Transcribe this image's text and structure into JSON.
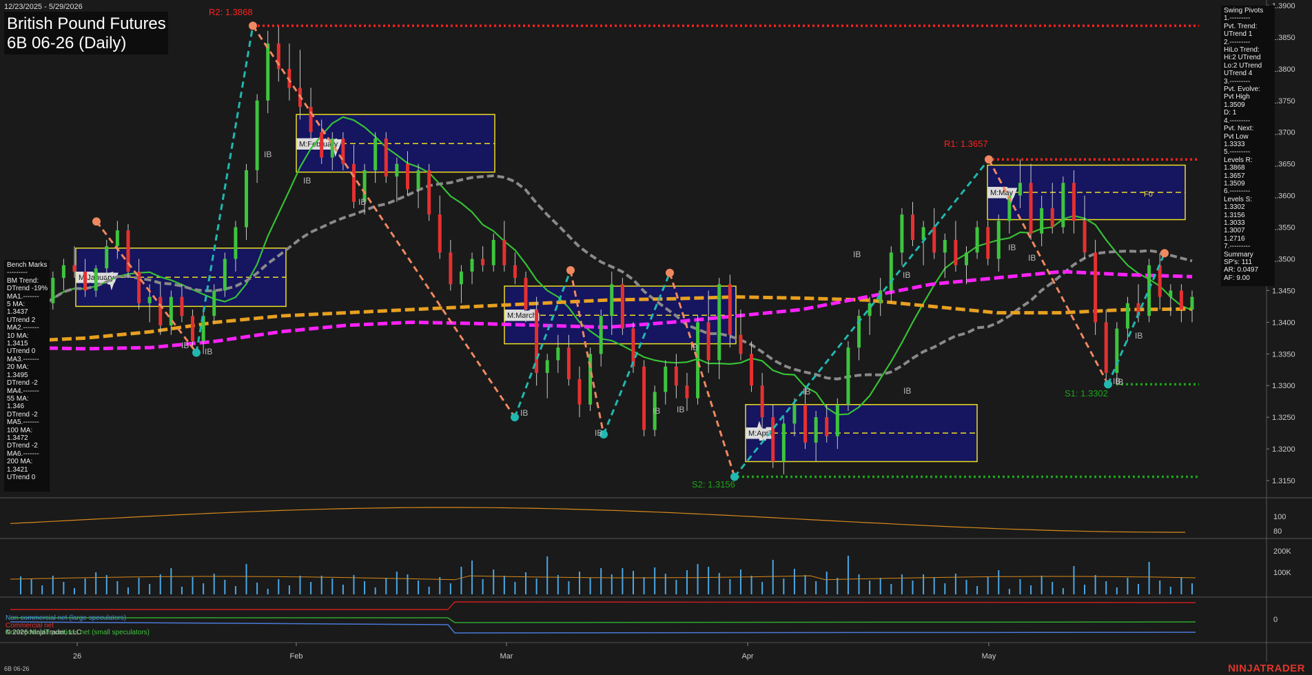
{
  "header": {
    "date_range": "12/23/2025 - 5/29/2026",
    "title_line1": "British Pound Futures",
    "title_line2": "6B 06-26 (Daily)"
  },
  "bench_marks": {
    "lines": [
      "Bench Marks",
      "---------",
      "BM Trend:",
      "DTrend -19%",
      "MA1.-------",
      "5 MA:",
      "1.3437",
      "UTrend 2",
      "MA2.-------",
      "10 MA:",
      "1.3415",
      "UTrend 0",
      "MA3.-------",
      "20 MA:",
      "1.3495",
      "DTrend -2",
      "MA4.-------",
      "55 MA:",
      "1.346",
      "DTrend -2",
      "MA5.-------",
      "100 MA:",
      "1.3472",
      "DTrend -2",
      "MA6.-------",
      "200 MA:",
      "1.3421",
      "UTrend 0"
    ]
  },
  "swing_pivots": {
    "lines": [
      "Swing Pivots",
      "1.---------",
      "Pvt. Trend:",
      "UTrend 1",
      "2.---------",
      "HiLo Trend:",
      "Hi:2 UTrend",
      "Lo:2 UTrend",
      "UTrend 4",
      "3.---------",
      "Pvt. Evolve:",
      "Pvt High",
      "1.3509",
      "D: 1",
      "4.---------",
      "Pvt. Next:",
      "Pvt Low",
      "1.3333",
      "5.---------",
      "Levels R:",
      "1.3868",
      "1.3657",
      "1.3509",
      "6.---------",
      "Levels S:",
      "1.3302",
      "1.3156",
      "1.3033",
      "1.3007",
      "1.2716",
      "7.---------",
      "Summary",
      "SP's: 111",
      "AR: 0.0497",
      "AF: 9.00"
    ]
  },
  "cot_legend": {
    "items": [
      {
        "label": "Non-commercial net (large speculators)",
        "color": "#4a90e2"
      },
      {
        "label": "Commercial net",
        "color": "#e53030"
      },
      {
        "label": "Nonreportable positions net (small speculators)",
        "color": "#3ec43e"
      }
    ]
  },
  "footer": {
    "copyright": "© 2026 NinjaTrader, LLC",
    "instrument": "6B 06-26",
    "brand": "NINJATRADER"
  },
  "colors": {
    "background": "#1a1a1a",
    "up_candle": "#3ec43e",
    "down_candle": "#e53030",
    "resistance": "#ff2020",
    "support": "#1aa51a",
    "ma_green": "#35c235",
    "ma_magenta": "#ff22ff",
    "ma_orange": "#e8a020",
    "ma_gray": "#8a8a8a",
    "swing_teal": "#20b8b0",
    "swing_salmon": "#f08860",
    "box_fill": "#151560",
    "box_border": "#f0e020"
  },
  "chart_data": {
    "type": "candlestick",
    "y_axis": {
      "min": 1.3125,
      "max": 1.39,
      "ticks": [
        "1.3150",
        "1.3200",
        "1.3250",
        "1.3300",
        "1.3350",
        "1.3400",
        "1.3450",
        "1.3500",
        "1.3550",
        "1.3600",
        "1.3650",
        "1.3700",
        "1.3750",
        "1.3800",
        "1.3850",
        "1.3900"
      ]
    },
    "x_axis": {
      "labels": [
        "26",
        "Feb",
        "Mar",
        "Apr",
        "May"
      ]
    },
    "levels": [
      {
        "label": "R2: 1.3868",
        "value": 1.3868,
        "kind": "resistance"
      },
      {
        "label": "R1: 1.3657",
        "value": 1.3657,
        "kind": "resistance"
      },
      {
        "label": "S1: 1.3302",
        "value": 1.3302,
        "kind": "support"
      },
      {
        "label": "S2: 1.3156",
        "value": 1.3156,
        "kind": "support"
      }
    ],
    "monthly_boxes": [
      {
        "label": "M:January",
        "high": 1.3517,
        "low": 1.3425,
        "mid": 1.3471
      },
      {
        "label": "M:February",
        "high": 1.3728,
        "low": 1.3637,
        "mid": 1.3682
      },
      {
        "label": "M:March",
        "high": 1.3457,
        "low": 1.3366,
        "mid": 1.3411
      },
      {
        "label": "M:April",
        "high": 1.327,
        "low": 1.318,
        "mid": 1.3225
      },
      {
        "label": "M:May",
        "high": 1.3648,
        "low": 1.3562,
        "mid": 1.3605
      }
    ],
    "fo_label": "F0",
    "ib_label": "IB",
    "candles": [
      [
        1.342,
        1.345,
        1.339,
        1.344
      ],
      [
        1.344,
        1.347,
        1.34,
        1.341
      ],
      [
        1.341,
        1.3445,
        1.339,
        1.343
      ],
      [
        1.343,
        1.348,
        1.342,
        1.347
      ],
      [
        1.347,
        1.35,
        1.345,
        1.349
      ],
      [
        1.349,
        1.352,
        1.347,
        1.348
      ],
      [
        1.348,
        1.35,
        1.344,
        1.345
      ],
      [
        1.345,
        1.349,
        1.344,
        1.3485
      ],
      [
        1.3485,
        1.353,
        1.347,
        1.352
      ],
      [
        1.352,
        1.356,
        1.35,
        1.3545
      ],
      [
        1.3545,
        1.3555,
        1.347,
        1.348
      ],
      [
        1.348,
        1.35,
        1.342,
        1.343
      ],
      [
        1.343,
        1.346,
        1.34,
        1.344
      ],
      [
        1.344,
        1.346,
        1.338,
        1.3395
      ],
      [
        1.3395,
        1.345,
        1.338,
        1.344
      ],
      [
        1.344,
        1.346,
        1.34,
        1.341
      ],
      [
        1.341,
        1.342,
        1.336,
        1.337
      ],
      [
        1.337,
        1.342,
        1.335,
        1.341
      ],
      [
        1.341,
        1.346,
        1.34,
        1.345
      ],
      [
        1.345,
        1.351,
        1.344,
        1.35
      ],
      [
        1.35,
        1.356,
        1.348,
        1.355
      ],
      [
        1.355,
        1.365,
        1.353,
        1.364
      ],
      [
        1.364,
        1.376,
        1.362,
        1.375
      ],
      [
        1.375,
        1.386,
        1.373,
        1.384
      ],
      [
        1.384,
        1.3868,
        1.378,
        1.38
      ],
      [
        1.38,
        1.384,
        1.375,
        1.377
      ],
      [
        1.377,
        1.383,
        1.372,
        1.374
      ],
      [
        1.374,
        1.377,
        1.368,
        1.37
      ],
      [
        1.37,
        1.372,
        1.365,
        1.366
      ],
      [
        1.366,
        1.37,
        1.364,
        1.369
      ],
      [
        1.369,
        1.37,
        1.364,
        1.365
      ],
      [
        1.365,
        1.368,
        1.358,
        1.359
      ],
      [
        1.359,
        1.365,
        1.357,
        1.364
      ],
      [
        1.364,
        1.37,
        1.362,
        1.369
      ],
      [
        1.369,
        1.37,
        1.362,
        1.363
      ],
      [
        1.363,
        1.366,
        1.359,
        1.365
      ],
      [
        1.365,
        1.367,
        1.36,
        1.361
      ],
      [
        1.361,
        1.365,
        1.358,
        1.364
      ],
      [
        1.364,
        1.365,
        1.356,
        1.357
      ],
      [
        1.357,
        1.36,
        1.35,
        1.351
      ],
      [
        1.351,
        1.353,
        1.345,
        1.346
      ],
      [
        1.346,
        1.349,
        1.343,
        1.348
      ],
      [
        1.348,
        1.351,
        1.346,
        1.35
      ],
      [
        1.35,
        1.352,
        1.348,
        1.349
      ],
      [
        1.349,
        1.354,
        1.348,
        1.353
      ],
      [
        1.353,
        1.356,
        1.348,
        1.349
      ],
      [
        1.349,
        1.351,
        1.346,
        1.347
      ],
      [
        1.347,
        1.348,
        1.34,
        1.342
      ],
      [
        1.342,
        1.344,
        1.33,
        1.332
      ],
      [
        1.332,
        1.335,
        1.328,
        1.334
      ],
      [
        1.334,
        1.338,
        1.332,
        1.336
      ],
      [
        1.336,
        1.338,
        1.33,
        1.331
      ],
      [
        1.331,
        1.333,
        1.325,
        1.327
      ],
      [
        1.327,
        1.336,
        1.326,
        1.335
      ],
      [
        1.335,
        1.342,
        1.333,
        1.341
      ],
      [
        1.341,
        1.348,
        1.338,
        1.346
      ],
      [
        1.346,
        1.347,
        1.338,
        1.339
      ],
      [
        1.339,
        1.34,
        1.332,
        1.333
      ],
      [
        1.333,
        1.334,
        1.322,
        1.323
      ],
      [
        1.323,
        1.33,
        1.322,
        1.329
      ],
      [
        1.329,
        1.334,
        1.327,
        1.333
      ],
      [
        1.333,
        1.335,
        1.328,
        1.33
      ],
      [
        1.33,
        1.332,
        1.326,
        1.328
      ],
      [
        1.328,
        1.341,
        1.327,
        1.34
      ],
      [
        1.34,
        1.345,
        1.332,
        1.334
      ],
      [
        1.334,
        1.347,
        1.331,
        1.346
      ],
      [
        1.346,
        1.3475,
        1.336,
        1.338
      ],
      [
        1.338,
        1.342,
        1.334,
        1.335
      ],
      [
        1.335,
        1.337,
        1.329,
        1.33
      ],
      [
        1.33,
        1.332,
        1.323,
        1.325
      ],
      [
        1.325,
        1.327,
        1.317,
        1.318
      ],
      [
        1.318,
        1.325,
        1.316,
        1.324
      ],
      [
        1.324,
        1.328,
        1.322,
        1.327
      ],
      [
        1.327,
        1.33,
        1.32,
        1.321
      ],
      [
        1.321,
        1.326,
        1.318,
        1.325
      ],
      [
        1.325,
        1.327,
        1.321,
        1.322
      ],
      [
        1.322,
        1.328,
        1.32,
        1.327
      ],
      [
        1.327,
        1.337,
        1.326,
        1.336
      ],
      [
        1.336,
        1.342,
        1.334,
        1.341
      ],
      [
        1.341,
        1.344,
        1.338,
        1.343
      ],
      [
        1.343,
        1.347,
        1.341,
        1.345
      ],
      [
        1.345,
        1.352,
        1.343,
        1.351
      ],
      [
        1.351,
        1.358,
        1.349,
        1.357
      ],
      [
        1.357,
        1.359,
        1.352,
        1.353
      ],
      [
        1.353,
        1.356,
        1.349,
        1.355
      ],
      [
        1.355,
        1.358,
        1.35,
        1.351
      ],
      [
        1.351,
        1.354,
        1.347,
        1.353
      ],
      [
        1.353,
        1.356,
        1.348,
        1.349
      ],
      [
        1.349,
        1.352,
        1.346,
        1.351
      ],
      [
        1.351,
        1.356,
        1.35,
        1.355
      ],
      [
        1.355,
        1.356,
        1.349,
        1.35
      ],
      [
        1.35,
        1.357,
        1.348,
        1.356
      ],
      [
        1.356,
        1.361,
        1.354,
        1.36
      ],
      [
        1.36,
        1.3657,
        1.358,
        1.362
      ],
      [
        1.362,
        1.365,
        1.353,
        1.354
      ],
      [
        1.354,
        1.36,
        1.352,
        1.358
      ],
      [
        1.358,
        1.362,
        1.354,
        1.355
      ],
      [
        1.355,
        1.363,
        1.354,
        1.362
      ],
      [
        1.362,
        1.364,
        1.354,
        1.356
      ],
      [
        1.356,
        1.36,
        1.35,
        1.351
      ],
      [
        1.351,
        1.353,
        1.338,
        1.34
      ],
      [
        1.34,
        1.342,
        1.331,
        1.332
      ],
      [
        1.332,
        1.34,
        1.3302,
        1.339
      ],
      [
        1.339,
        1.344,
        1.337,
        1.343
      ],
      [
        1.343,
        1.346,
        1.34,
        1.341
      ],
      [
        1.341,
        1.35,
        1.34,
        1.349
      ],
      [
        1.349,
        1.3509,
        1.342,
        1.344
      ],
      [
        1.344,
        1.346,
        1.341,
        1.345
      ],
      [
        1.345,
        1.346,
        1.34,
        1.342
      ],
      [
        1.342,
        1.345,
        1.34,
        1.344
      ]
    ]
  },
  "oscillator": {
    "ticks": [
      "100",
      "80"
    ]
  },
  "volume": {
    "ticks": [
      "200K",
      "100K"
    ]
  },
  "cot": {
    "ticks": [
      "0"
    ]
  }
}
